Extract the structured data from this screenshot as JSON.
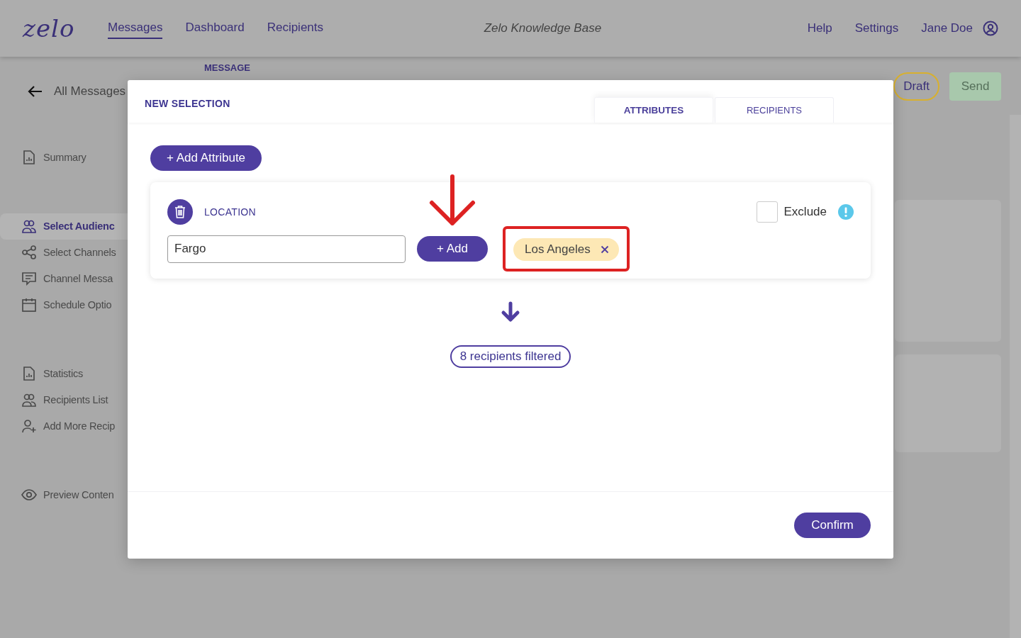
{
  "header": {
    "logo": "zelo",
    "nav": [
      {
        "label": "Messages",
        "selected": true
      },
      {
        "label": "Dashboard",
        "selected": false
      },
      {
        "label": "Recipients",
        "selected": false
      }
    ],
    "center_title": "Zelo Knowledge Base",
    "links": [
      "Help",
      "Settings"
    ],
    "user": "Jane Doe"
  },
  "back_link": "All Messages",
  "section_label": "MESSAGE",
  "draft_button": "Draft",
  "send_button": {
    "label": "Send",
    "disabled": true
  },
  "sidebar": [
    {
      "items": [
        {
          "kind": "report",
          "label": "Summary",
          "selected": false
        }
      ]
    },
    {
      "items": [
        {
          "kind": "people",
          "label": "Select Audienc",
          "selected": true
        },
        {
          "kind": "share",
          "label": "Select Channels",
          "selected": false
        },
        {
          "kind": "chat",
          "label": "Channel Messa",
          "selected": false
        },
        {
          "kind": "calendar",
          "label": "Schedule Optio",
          "selected": false
        }
      ]
    },
    {
      "items": [
        {
          "kind": "report",
          "label": "Statistics",
          "selected": false
        },
        {
          "kind": "people",
          "label": "Recipients List",
          "selected": false
        },
        {
          "kind": "person-add",
          "label": "Add More Recip",
          "selected": false
        }
      ]
    },
    {
      "items": [
        {
          "kind": "eye",
          "label": "Preview Conten",
          "selected": false
        }
      ]
    }
  ],
  "modal": {
    "title": "NEW SELECTION",
    "tabs": [
      {
        "label": "ATTRIBUTES",
        "selected": true
      },
      {
        "label": "RECIPIENTS",
        "selected": false
      }
    ],
    "add_attribute_button": "+ Add Attribute",
    "attribute": {
      "name": "LOCATION",
      "input_value": "Fargo",
      "add_button": "+ Add",
      "chips": [
        {
          "label": "Los Angeles",
          "highlighted": true
        }
      ],
      "exclude": {
        "label": "Exclude",
        "checked": false
      }
    },
    "result": "8 recipients filtered",
    "confirm_button": "Confirm"
  }
}
